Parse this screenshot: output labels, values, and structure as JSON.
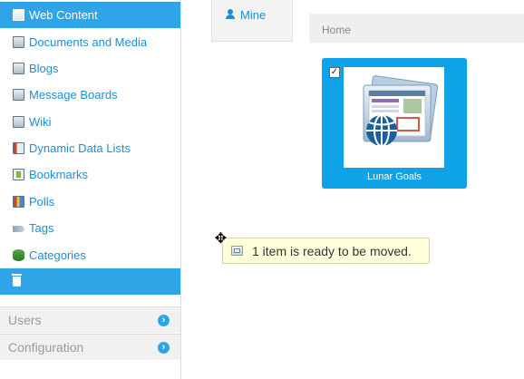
{
  "sidebar": {
    "items": [
      {
        "label": "Web Content",
        "icon": "web-content-icon",
        "active": true
      },
      {
        "label": "Documents and Media",
        "icon": "documents-media-icon"
      },
      {
        "label": "Blogs",
        "icon": "blogs-icon"
      },
      {
        "label": "Message Boards",
        "icon": "message-boards-icon"
      },
      {
        "label": "Wiki",
        "icon": "wiki-icon"
      },
      {
        "label": "Dynamic Data Lists",
        "icon": "dynamic-data-lists-icon"
      },
      {
        "label": "Bookmarks",
        "icon": "bookmarks-icon"
      },
      {
        "label": "Polls",
        "icon": "polls-icon"
      },
      {
        "label": "Tags",
        "icon": "tag-icon"
      },
      {
        "label": "Categories",
        "icon": "categories-icon"
      },
      {
        "label": "",
        "icon": "trash-icon",
        "active": true
      }
    ],
    "sections": [
      {
        "label": "Users",
        "icon": "chevron-right-icon"
      },
      {
        "label": "Configuration",
        "icon": "chevron-right-icon"
      }
    ]
  },
  "main": {
    "tab_mine": "Mine",
    "breadcrumb": "Home",
    "card": {
      "title": "Lunar Goals",
      "checked": true,
      "icon": "web-content-article-icon"
    },
    "tooltip": "1 item is ready to be moved."
  },
  "colors": {
    "accent": "#2fa4e7",
    "card_bg": "#0ea2e6",
    "link": "#1f8ed0",
    "tooltip_bg": "#ffffdc"
  }
}
